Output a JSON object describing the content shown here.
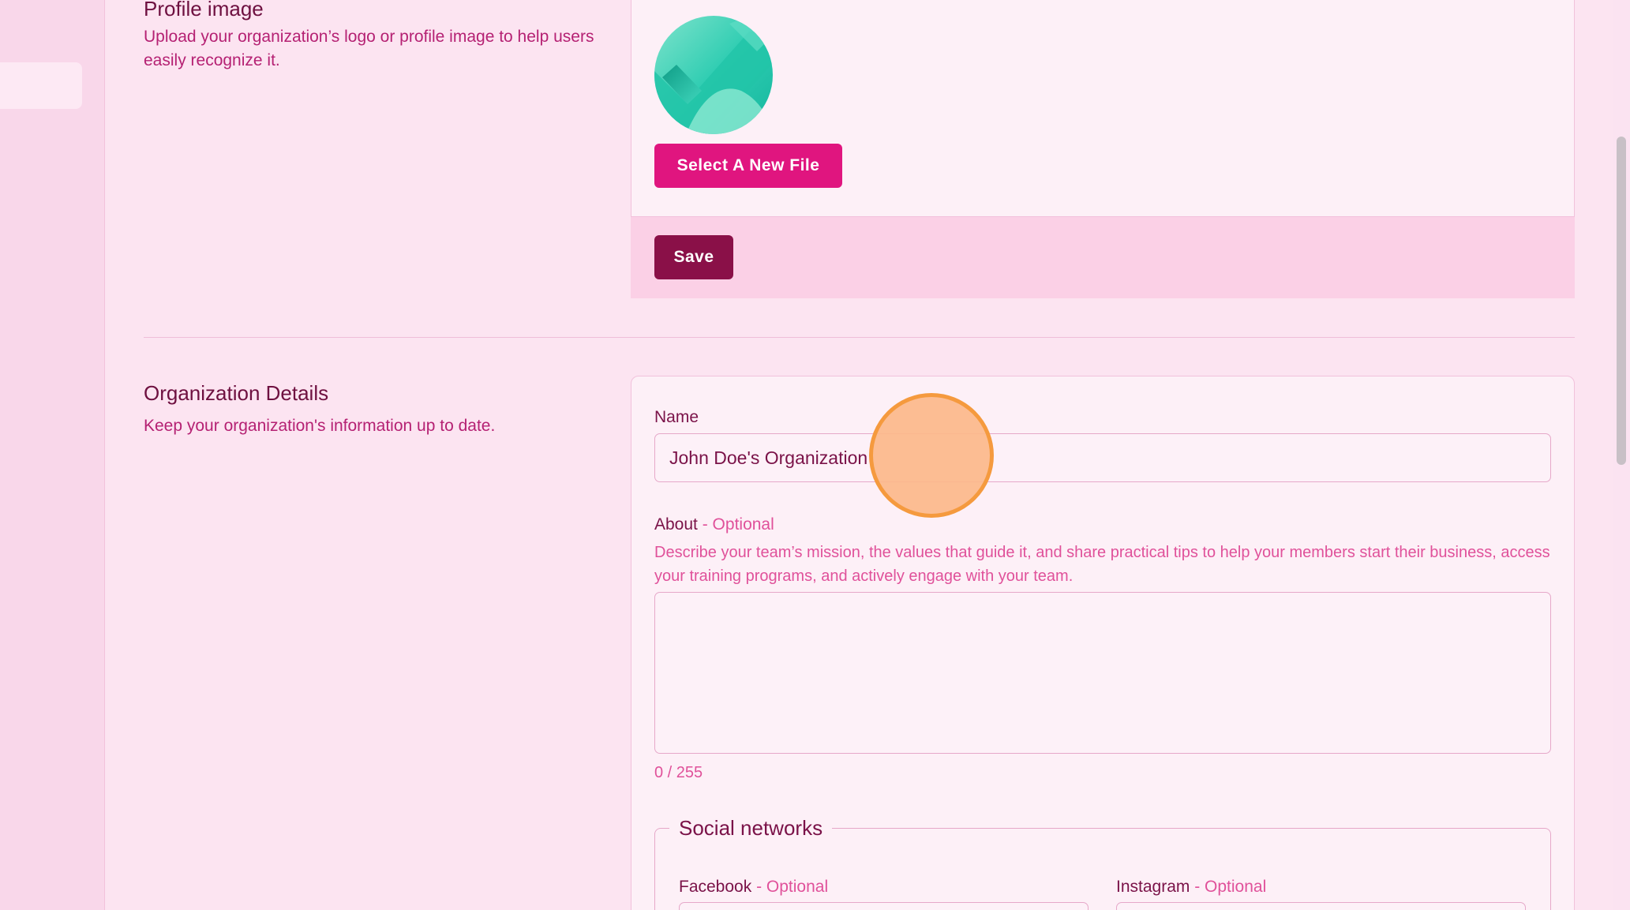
{
  "profile_image": {
    "title": "Profile image",
    "description": "Upload your organization’s logo or profile image to help users easily recognize it.",
    "select_button": "Select A New File",
    "save_button": "Save"
  },
  "org_details": {
    "title": "Organization Details",
    "description": "Keep your organization's information up to date.",
    "name_label": "Name",
    "name_value": "John Doe's Organization",
    "about_label": "About",
    "optional_suffix": " - Optional",
    "about_helper": "Describe your team’s mission, the values that guide it, and share practical tips to help your members start their business, access your training programs, and actively engage with your team.",
    "about_value": "",
    "about_counter": "0 / 255"
  },
  "social": {
    "legend": "Social networks",
    "facebook_label": "Facebook",
    "instagram_label": "Instagram",
    "optional_suffix": " - Optional"
  },
  "colors": {
    "accent": "#e0157f",
    "save": "#8a1048",
    "background": "#fce4f1"
  }
}
